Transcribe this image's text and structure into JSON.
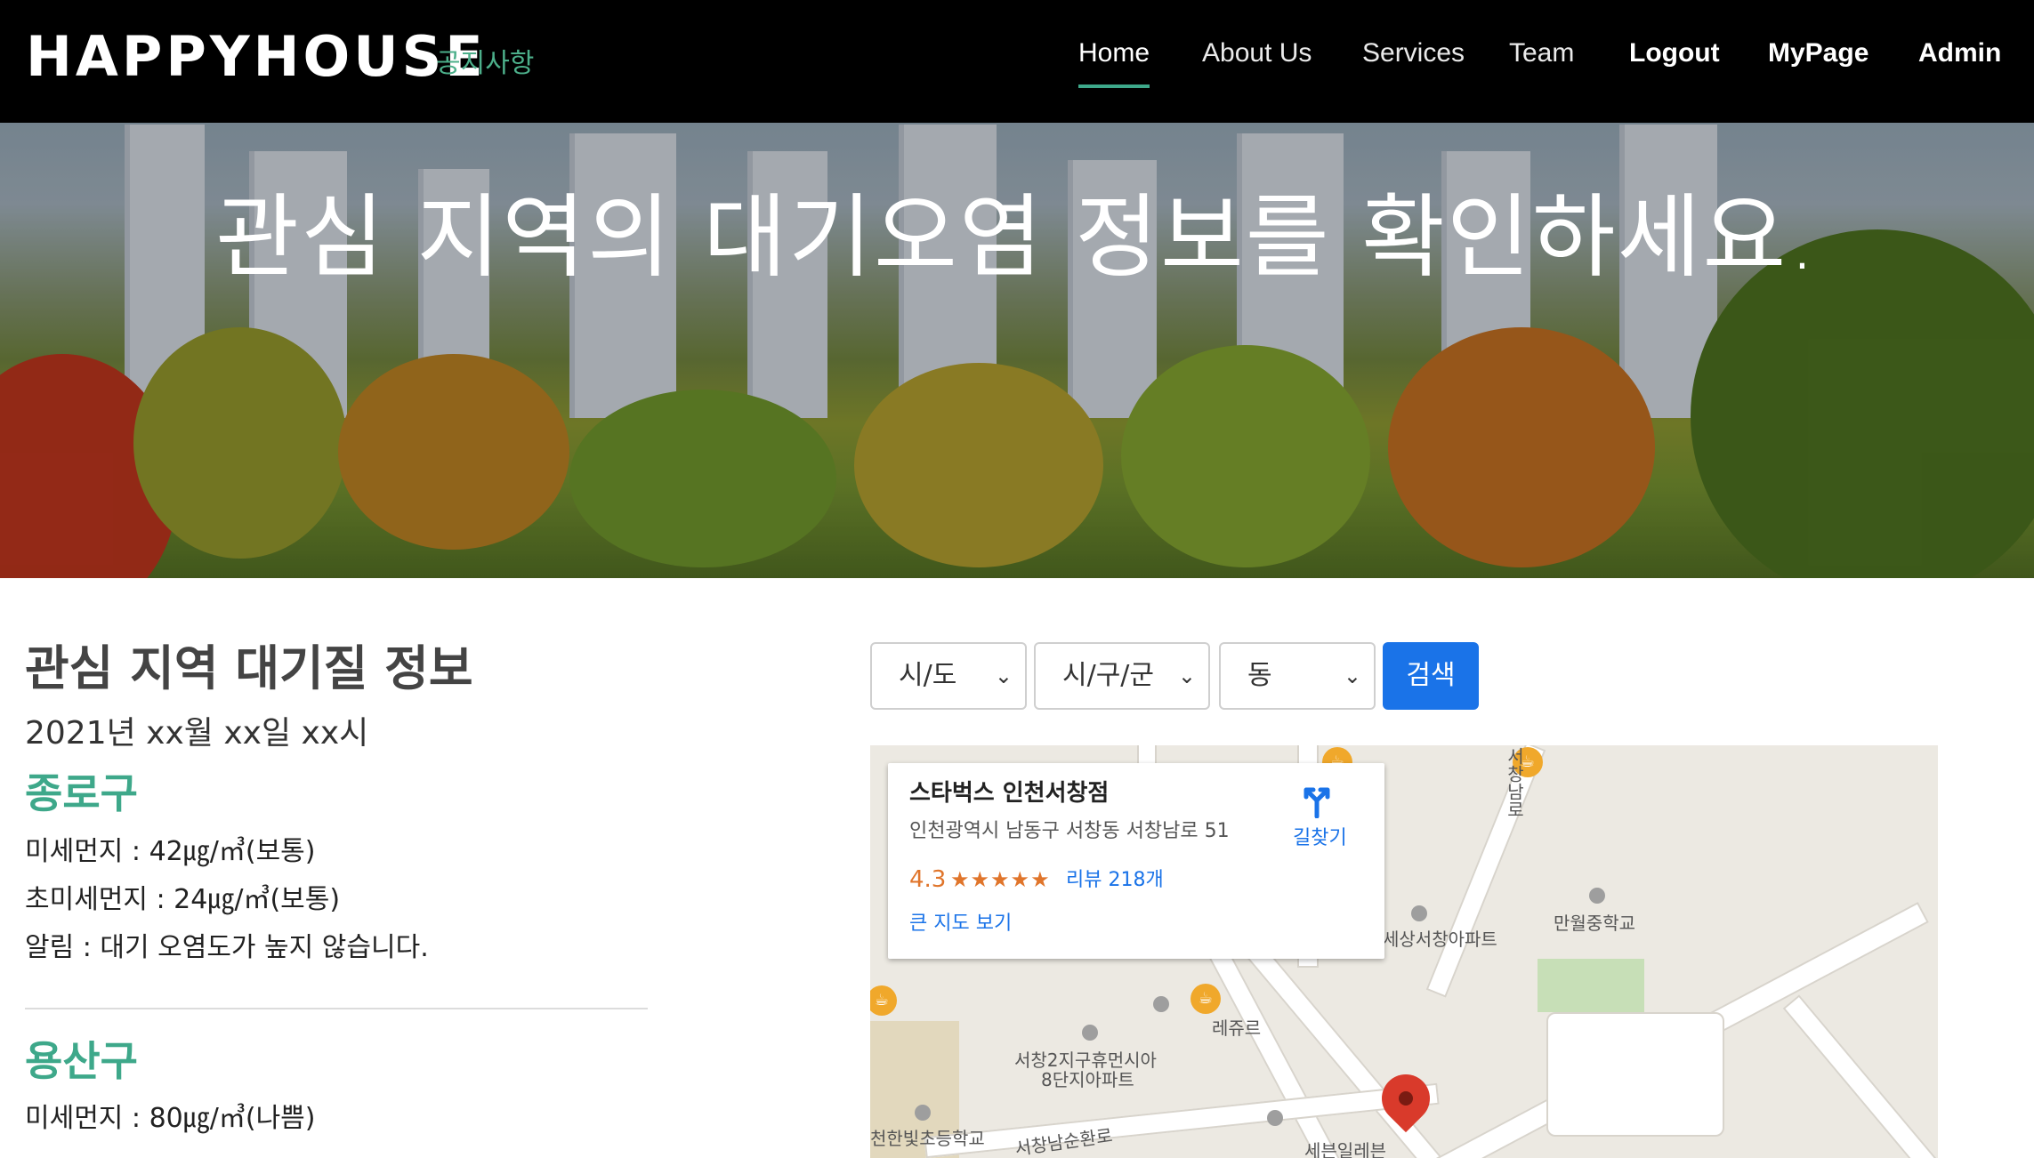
{
  "navbar": {
    "brand": "HAPPYHOUSE",
    "brand_sub": "공지사항",
    "items": [
      {
        "label": "Home"
      },
      {
        "label": "About Us"
      },
      {
        "label": "Services"
      },
      {
        "label": "Team"
      },
      {
        "label": "Logout"
      },
      {
        "label": "MyPage"
      },
      {
        "label": "Admin"
      }
    ]
  },
  "hero": {
    "title": "관심 지역의 대기오염 정보를 확인하세요."
  },
  "air": {
    "title": "관심 지역 대기질 정보",
    "date": "2021년 xx월 xx일 xx시",
    "districts": [
      {
        "name": "종로구",
        "pm10": "미세먼지 : 42㎍/㎥(보통)",
        "pm25": "초미세먼지 : 24㎍/㎥(보통)",
        "alert": "알림 : 대기 오염도가 높지 않습니다."
      },
      {
        "name": "용산구",
        "pm10": "미세먼지 : 80㎍/㎥(나쁨)"
      }
    ]
  },
  "search": {
    "sido": "시/도",
    "gugun": "시/구/군",
    "dong": "동",
    "button": "검색"
  },
  "map": {
    "card": {
      "title": "스타벅스 인천서창점",
      "address": "인천광역시 남동구 서창동 서창남로 51",
      "rating": "4.3",
      "stars": "★★★★★",
      "reviews": "리뷰 218개",
      "big_map": "큰 지도 보기",
      "directions": "길찾기"
    },
    "labels": {
      "apt1": "세상서창아파트",
      "school1": "만월중학교",
      "cafe2": "레쥬르",
      "apt2_line1": "서창2지구휴먼시아",
      "apt2_line2": "8단지아파트",
      "school2": "천한빛초등학교",
      "road1": "서창남순환로",
      "mart": "세븐일레븐",
      "road2": "서창남로"
    }
  }
}
